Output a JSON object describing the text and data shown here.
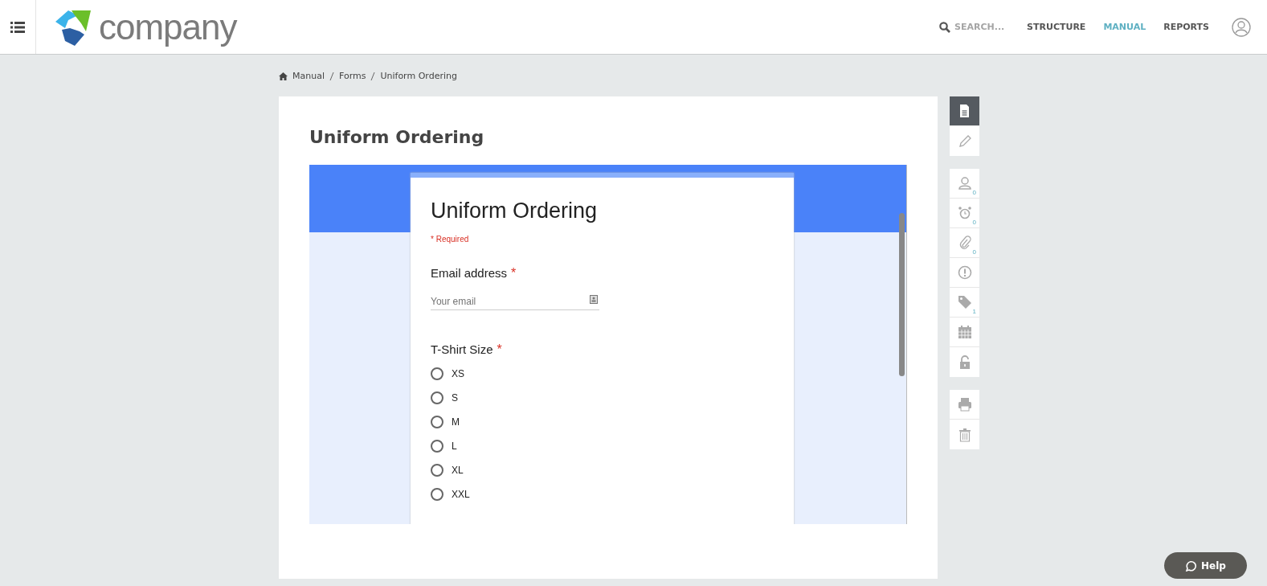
{
  "header": {
    "logo_text": "company",
    "search": {
      "placeholder": "SEARCH..."
    },
    "nav": [
      {
        "label": "STRUCTURE",
        "selected": false
      },
      {
        "label": "MANUAL",
        "selected": true
      },
      {
        "label": "REPORTS",
        "selected": false
      }
    ]
  },
  "breadcrumb": [
    "Manual",
    "Forms",
    "Uniform Ordering"
  ],
  "page_title": "Uniform Ordering",
  "form": {
    "title": "Uniform Ordering",
    "required_note": "* Required",
    "questions": [
      {
        "kind": "text",
        "label": "Email address",
        "required_mark": "*",
        "placeholder": "Your email"
      },
      {
        "kind": "radio",
        "label": "T-Shirt Size",
        "required_mark": "*",
        "options": [
          {
            "label": "XS",
            "selected": false
          },
          {
            "label": "S",
            "selected": false
          },
          {
            "label": "M",
            "selected": false
          },
          {
            "label": "L",
            "selected": false
          },
          {
            "label": "XL",
            "selected": false
          },
          {
            "label": "XXL",
            "selected": false
          }
        ]
      }
    ]
  },
  "toolbar": [
    [
      {
        "kind": "document",
        "selected": true
      },
      {
        "kind": "pencil",
        "selected": false
      }
    ],
    [
      {
        "kind": "person",
        "selected": false,
        "count": "0"
      },
      {
        "kind": "alarm",
        "selected": false,
        "count": "0"
      },
      {
        "kind": "paperclip",
        "selected": false,
        "count": "0"
      },
      {
        "kind": "alert",
        "selected": false
      },
      {
        "kind": "tag",
        "selected": false,
        "count": "1"
      },
      {
        "kind": "calendar",
        "selected": false
      },
      {
        "kind": "lock",
        "selected": false
      }
    ],
    [
      {
        "kind": "printer",
        "selected": false
      },
      {
        "kind": "trash",
        "selected": false
      }
    ]
  ],
  "help": {
    "label": "Help"
  }
}
